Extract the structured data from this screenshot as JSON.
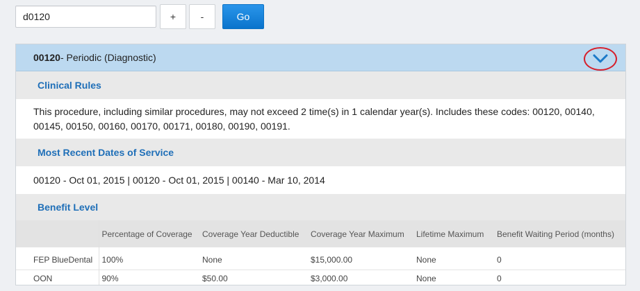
{
  "search": {
    "value": "d0120",
    "plus_label": "+",
    "minus_label": "-",
    "go_label": "Go"
  },
  "panel": {
    "code": "00120",
    "title_rest": " - Periodic (Diagnostic)",
    "sections": {
      "clinical_rules": {
        "title": "Clinical Rules",
        "text": "This procedure, including similar procedures, may not exceed 2 time(s) in 1 calendar year(s). Includes these codes: 00120, 00140, 00145, 00150, 00160, 00170, 00171, 00180, 00190, 00191."
      },
      "recent_dates": {
        "title": "Most Recent Dates of Service",
        "text": "00120 - Oct 01, 2015 | 00120 - Oct 01, 2015 | 00140 - Mar 10, 2014"
      },
      "benefit_level": {
        "title": "Benefit Level",
        "columns": [
          "",
          "Percentage of Coverage",
          "Coverage Year Deductible",
          "Coverage Year Maximum",
          "Lifetime Maximum",
          "Benefit Waiting Period (months)"
        ],
        "rows": [
          [
            "FEP BlueDental",
            "100%",
            "None",
            "$15,000.00",
            "None",
            "0"
          ],
          [
            "OON",
            "90%",
            "$50.00",
            "$3,000.00",
            "None",
            "0"
          ]
        ]
      }
    }
  },
  "icons": {
    "collapse": "chevron-down-icon"
  },
  "colors": {
    "header_bg": "#bcd9f0",
    "section_title": "#1f6fb8",
    "go_button": "#0a74cc",
    "highlight_circle": "#d6202c"
  }
}
